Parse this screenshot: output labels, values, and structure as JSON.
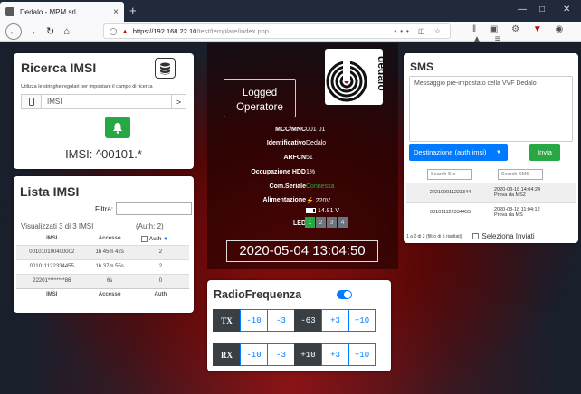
{
  "browser": {
    "tab_title": "Dedalo - MPM srl",
    "tab_close": "×",
    "new_tab": "+",
    "url_host": "https://192.168.22.10",
    "url_path": "/test/template/index.php",
    "url_dots": "•••"
  },
  "ricerca": {
    "title": "Ricerca IMSI",
    "hint": "Utilizza le stringhe regolari per impostare il campo di ricerca",
    "input_value": "IMSI",
    "go_label": ">",
    "filter_display": "IMSI: ^00101.*"
  },
  "lista": {
    "title": "Lista IMSI",
    "filter_label": "Filtra:",
    "summary": "Visualizzati 3 di 3 IMSI",
    "auth_count": "(Auth: 2)",
    "columns": [
      "IMSI",
      "Accesso",
      "Auth"
    ],
    "rows": [
      {
        "imsi": "001010100400002",
        "accesso": "1h 45m 42s",
        "auth": "2"
      },
      {
        "imsi": "001011122334455",
        "accesso": "1h 37m 55s",
        "auth": "2"
      },
      {
        "imsi": "22201********86",
        "accesso": "6s",
        "auth": "0"
      }
    ],
    "footer": [
      "IMSI",
      "Accesso",
      "Auth"
    ]
  },
  "status": {
    "logged_line1": "Logged",
    "logged_line2": "Operatore",
    "logo_text": "dedalo",
    "items": [
      {
        "key": "MCC/MNC",
        "value": "001 01",
        "color": "#ffffff"
      },
      {
        "key": "Identificativo",
        "value": "Dedalo",
        "color": "#ffffff"
      },
      {
        "key": "ARFCN",
        "value": "51",
        "color": "#ffffff"
      },
      {
        "key": "Occupazione HDD",
        "value": "1%",
        "color": "#ffffff"
      },
      {
        "key": "Com.Seriale",
        "value": "Connessa",
        "color": "#28a745"
      }
    ],
    "alimentazione_label": "Alimentazione",
    "ac_voltage": "220V",
    "battery_voltage": "14.81 V",
    "led_label": "LED",
    "leds": [
      {
        "n": "1",
        "on": true
      },
      {
        "n": "2",
        "on": false
      },
      {
        "n": "3",
        "on": false
      },
      {
        "n": "4",
        "on": false
      }
    ],
    "datetime": "2020-05-04 13:04:50"
  },
  "rf": {
    "title": "RadioFrequenza",
    "enabled": true,
    "tx": {
      "label": "TX",
      "cells": [
        "-10",
        "-3",
        "-63",
        "+3",
        "+10"
      ],
      "current": "-63"
    },
    "rx": {
      "label": "RX",
      "cells": [
        "-10",
        "-3",
        "+10",
        "+3",
        "+10"
      ],
      "current": "+10"
    }
  },
  "sms": {
    "title": "SMS",
    "message": "Messaggio pre-impostato cella VVF Dedalo",
    "dest_label": "Destinazione (auth imsi)",
    "send_label": "Invia",
    "search_src_placeholder": "Search Src",
    "search_sms_placeholder": "Search SMS",
    "rows": [
      {
        "src": "222100011223344",
        "date": "2020-03-18 14:04:24",
        "text": "Prova da MS2"
      },
      {
        "src": "001011122334455",
        "date": "2020-03-18 11:04:12",
        "text": "Prova da MS"
      }
    ],
    "footer_info": "1 a 2 di 2 (filtro di 5 risultati)",
    "select_sent_label": "Seleziona Inviati"
  },
  "colors": {
    "primary": "#007bff",
    "success": "#28a745",
    "dark": "#3a3f44"
  }
}
